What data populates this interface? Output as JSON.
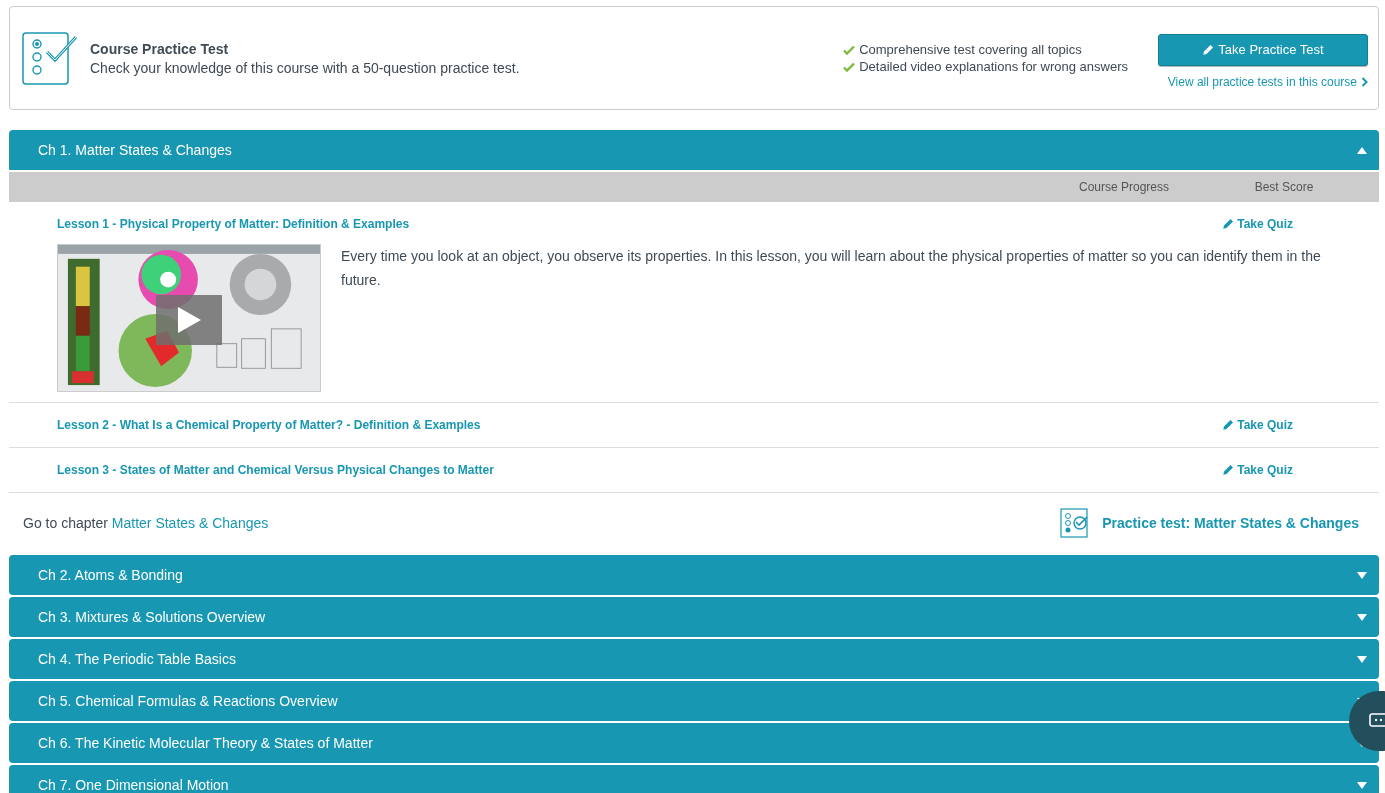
{
  "practice_test": {
    "title": "Course Practice Test",
    "subtitle": "Check your knowledge of this course with a 50-question practice test.",
    "features": [
      "Comprehensive test covering all topics",
      "Detailed video explanations for wrong answers"
    ],
    "button": "Take Practice Test",
    "link": "View all practice tests in this course"
  },
  "chapters": [
    {
      "title": "Ch 1. Matter States & Changes",
      "expanded": true,
      "columns": [
        "Course Progress",
        "Best Score"
      ],
      "lessons": [
        {
          "title": "Lesson 1 - Physical Property of Matter: Definition & Examples",
          "action": "Take Quiz",
          "description": "Every time you look at an object, you observe its properties. In this lesson, you will learn about the physical properties of matter so you can identify them in the future."
        },
        {
          "title": "Lesson 2 - What Is a Chemical Property of Matter? - Definition & Examples",
          "action": "Take Quiz"
        },
        {
          "title": "Lesson 3 - States of Matter and Chemical Versus Physical Changes to Matter",
          "action": "Take Quiz"
        }
      ],
      "goto_prefix": "Go to chapter",
      "goto_link": "Matter States & Changes",
      "practice_link": "Practice test: Matter States & Changes"
    },
    {
      "title": "Ch 2. Atoms & Bonding",
      "expanded": false
    },
    {
      "title": "Ch 3. Mixtures & Solutions Overview",
      "expanded": false
    },
    {
      "title": "Ch 4. The Periodic Table Basics",
      "expanded": false
    },
    {
      "title": "Ch 5. Chemical Formulas & Reactions Overview",
      "expanded": false
    },
    {
      "title": "Ch 6. The Kinetic Molecular Theory & States of Matter",
      "expanded": false
    },
    {
      "title": "Ch 7. One Dimensional Motion",
      "expanded": false
    }
  ]
}
